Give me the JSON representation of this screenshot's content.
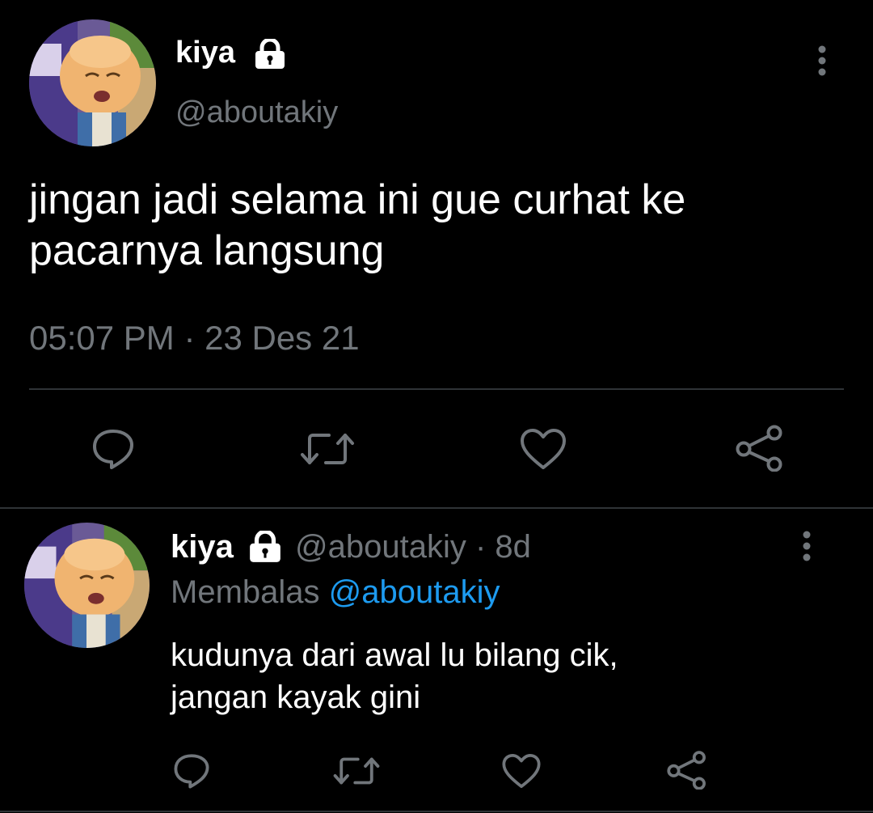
{
  "main_tweet": {
    "display_name": "kiya",
    "handle": "@aboutakiy",
    "text_line1": "jingan jadi selama ini gue curhat ke",
    "text_line2": "pacarnya langsung",
    "timestamp": "05:07 PM · 23 Des 21"
  },
  "reply_tweet": {
    "display_name": "kiya",
    "handle": "@aboutakiy",
    "age": "· 8d",
    "replying_label": "Membalas",
    "replying_to": "@aboutakiy",
    "text_line1": "kudunya dari awal lu bilang cik,",
    "text_line2": "jangan kayak gini"
  },
  "icons": {
    "lock": "lock-icon",
    "more": "more-vertical-icon",
    "reply": "reply-icon",
    "retweet": "retweet-icon",
    "like": "heart-icon",
    "share": "share-icon"
  },
  "colors": {
    "background": "#000000",
    "text": "#ffffff",
    "muted": "#71767b",
    "accent": "#1d9bf0",
    "divider": "#2f3336"
  }
}
